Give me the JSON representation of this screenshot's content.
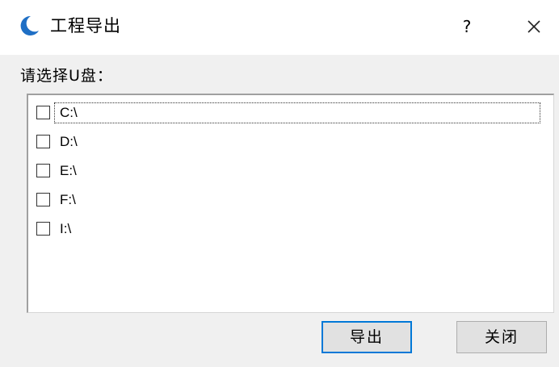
{
  "window": {
    "title": "工程导出",
    "help_label": "?",
    "icon": "app-logo-icon",
    "close_icon": "close-icon",
    "accent": "#1f6fc5"
  },
  "main": {
    "prompt": "请选择U盘：",
    "drives": [
      {
        "label": "C:\\",
        "checked": false,
        "focused": true
      },
      {
        "label": "D:\\",
        "checked": false,
        "focused": false
      },
      {
        "label": "E:\\",
        "checked": false,
        "focused": false
      },
      {
        "label": "F:\\",
        "checked": false,
        "focused": false
      },
      {
        "label": "I:\\",
        "checked": false,
        "focused": false
      }
    ]
  },
  "buttons": {
    "export_label": "导出",
    "close_label": "关闭"
  }
}
